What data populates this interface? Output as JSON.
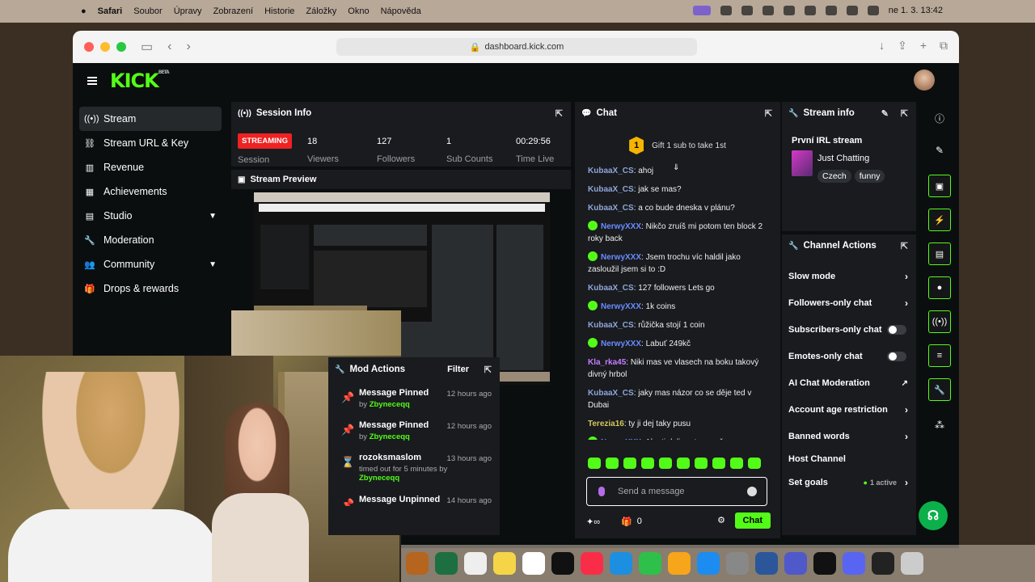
{
  "menubar": {
    "app": "Safari",
    "items": [
      "Soubor",
      "Úpravy",
      "Zobrazení",
      "Historie",
      "Záložky",
      "Okno",
      "Nápověda"
    ],
    "clock": "ne 1. 3. 13:42"
  },
  "browser": {
    "url": "dashboard.kick.com"
  },
  "brand": {
    "logo": "KICK",
    "beta": "BETA"
  },
  "sidebar": {
    "items": [
      {
        "label": "Stream",
        "icon": "broadcast-icon"
      },
      {
        "label": "Stream URL & Key",
        "icon": "link-icon"
      },
      {
        "label": "Revenue",
        "icon": "chart-icon"
      },
      {
        "label": "Achievements",
        "icon": "trophy-icon"
      },
      {
        "label": "Studio",
        "icon": "grid-icon"
      },
      {
        "label": "Moderation",
        "icon": "wrench-icon"
      },
      {
        "label": "Community",
        "icon": "people-icon"
      },
      {
        "label": "Drops & rewards",
        "icon": "gift-icon"
      }
    ]
  },
  "session": {
    "title": "Session Info",
    "status": "STREAMING",
    "status_label": "Session",
    "viewers": "18",
    "viewers_label": "Viewers",
    "followers": "127",
    "followers_label": "Followers",
    "subs": "1",
    "subs_label": "Sub Counts",
    "time": "00:29:56",
    "time_label": "Time Live"
  },
  "preview": {
    "title": "Stream Preview"
  },
  "mod_actions": {
    "title": "Mod Actions",
    "filter": "Filter",
    "items": [
      {
        "title": "Message Pinned",
        "by": "by",
        "user": "Zbyneceqq",
        "time": "12 hours ago"
      },
      {
        "title": "Message Pinned",
        "by": "by",
        "user": "Zbyneceqq",
        "time": "12 hours ago"
      },
      {
        "title": "rozoksmaslom",
        "by": "timed out for 5 minutes by",
        "user": "Zbyneceqq",
        "time": "13 hours ago"
      },
      {
        "title": "Message Unpinned",
        "by": "",
        "user": "",
        "time": "14 hours ago"
      }
    ]
  },
  "chat": {
    "title": "Chat",
    "gift_count": "1",
    "gift_text": "Gift 1 sub to take 1st",
    "messages": [
      {
        "user": "KubaaX_CS",
        "text": "ahoj",
        "verified": false,
        "color": "#8fa6d8"
      },
      {
        "user": "KubaaX_CS",
        "text": "jak se mas?",
        "verified": false,
        "color": "#8fa6d8"
      },
      {
        "user": "KubaaX_CS",
        "text": "a co bude dneska v plánu?",
        "verified": false,
        "color": "#8fa6d8"
      },
      {
        "user": "NerwyXXX",
        "text": "Nikčo zruíš mi potom ten block 2 roky back",
        "verified": true,
        "color": "#6a8cff"
      },
      {
        "user": "NerwyXXX",
        "text": "Jsem trochu víc haldil jako zasloužil jsem si to :D",
        "verified": true,
        "color": "#6a8cff"
      },
      {
        "user": "KubaaX_CS",
        "text": "127 followers Lets go",
        "verified": false,
        "color": "#8fa6d8"
      },
      {
        "user": "NerwyXXX",
        "text": "1k coins",
        "verified": true,
        "color": "#6a8cff"
      },
      {
        "user": "KubaaX_CS",
        "text": "růžička stojí 1 coin",
        "verified": false,
        "color": "#8fa6d8"
      },
      {
        "user": "NerwyXXX",
        "text": "Labuť 249kč",
        "verified": true,
        "color": "#6a8cff"
      },
      {
        "user": "Kla_rka45",
        "text": "Niki mas ve vlasech na boku takový divný hrbol",
        "verified": false,
        "color": "#c77dff"
      },
      {
        "user": "KubaaX_CS",
        "text": "jaky mas názor co se děje ted v Dubai",
        "verified": false,
        "color": "#8fa6d8"
      },
      {
        "user": "Terezia16",
        "text": "ty ji dej taky pusu",
        "verified": false,
        "color": "#d4c85a"
      },
      {
        "user": "NerwyXXX",
        "text": "Aby ti dali partnera už",
        "verified": true,
        "color": "#6a8cff"
      }
    ],
    "placeholder": "Send a message",
    "kick_count": "0",
    "send_label": "Chat"
  },
  "stream_info": {
    "title": "Stream info",
    "stream_title": "První IRL stream",
    "category": "Just Chatting",
    "tags": [
      "Czech",
      "funny"
    ]
  },
  "channel_actions": {
    "title": "Channel Actions",
    "items": [
      {
        "label": "Slow mode",
        "control": "arrow"
      },
      {
        "label": "Followers-only chat",
        "control": "arrow"
      },
      {
        "label": "Subscribers-only chat",
        "control": "toggle"
      },
      {
        "label": "Emotes-only chat",
        "control": "toggle"
      },
      {
        "label": "AI Chat Moderation",
        "control": "external"
      },
      {
        "label": "Account age restriction",
        "control": "arrow"
      },
      {
        "label": "Banned words",
        "control": "arrow"
      },
      {
        "label": "Host Channel",
        "control": "none"
      },
      {
        "label": "Set goals",
        "control": "arrow",
        "extra": "1 active"
      }
    ]
  },
  "colors": {
    "accent": "#53fc18",
    "live": "#e22222",
    "panel": "#191b1f",
    "bg": "#0b0e0f"
  }
}
